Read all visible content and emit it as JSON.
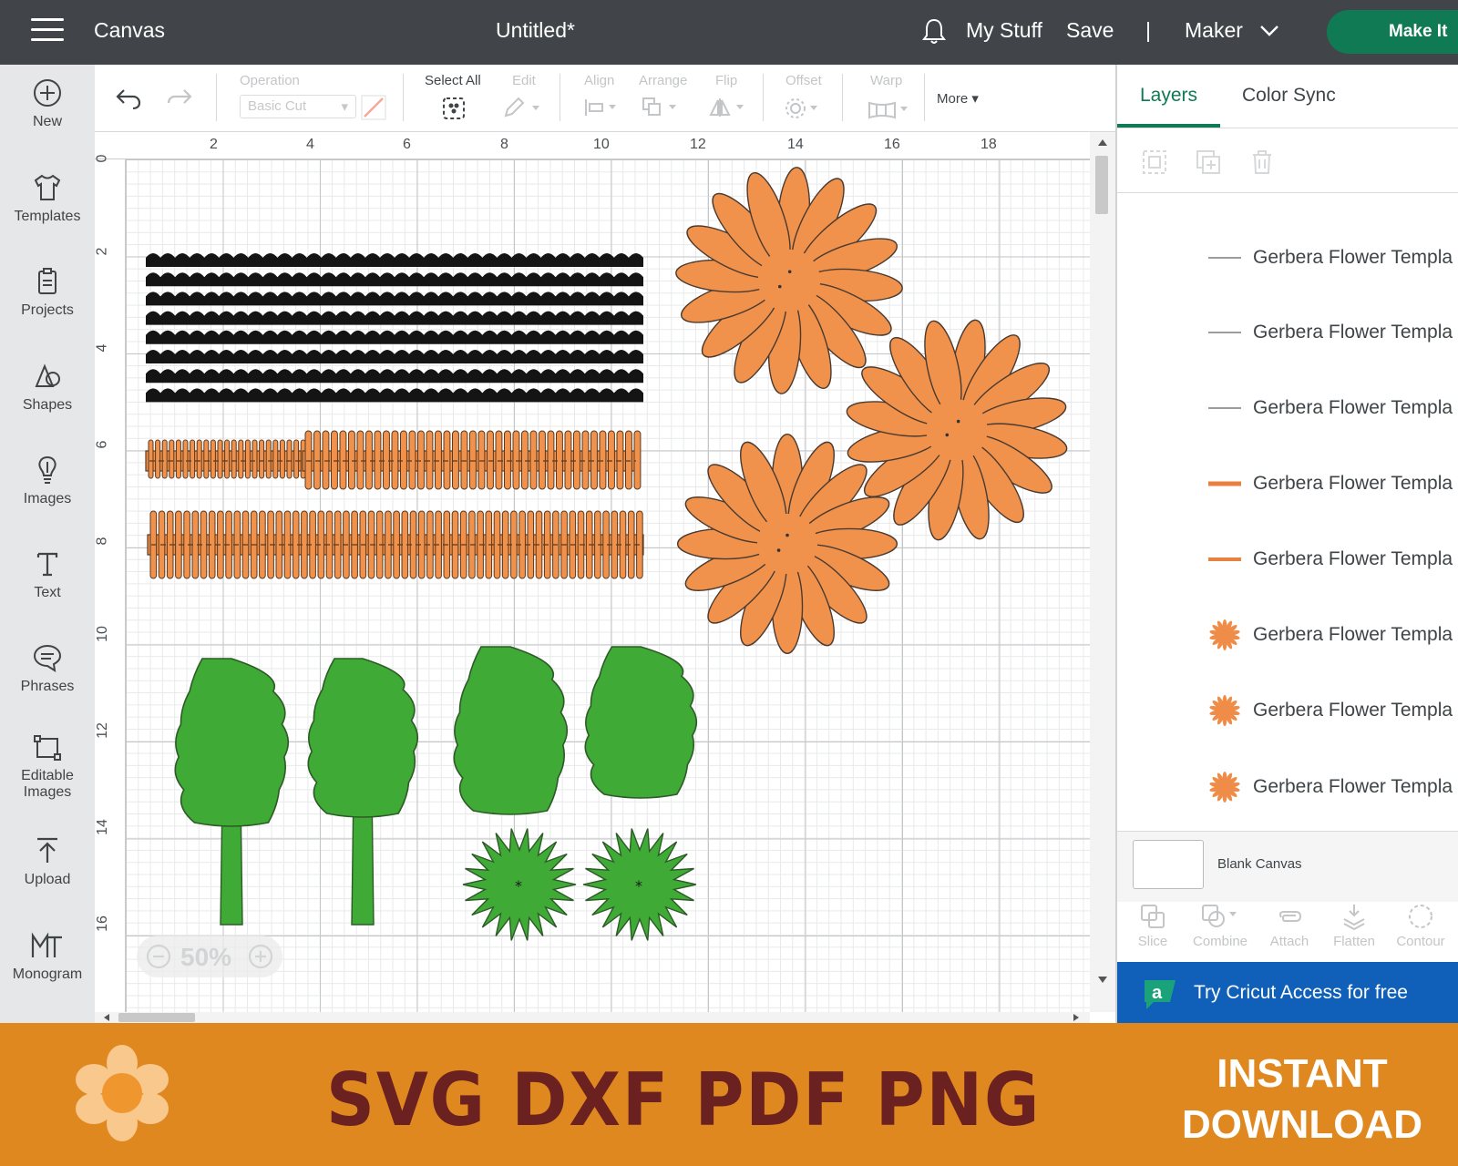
{
  "topbar": {
    "canvas_label": "Canvas",
    "doc_title": "Untitled*",
    "my_stuff": "My Stuff",
    "save": "Save",
    "divider": "|",
    "machine": "Maker",
    "make_it": "Make It"
  },
  "sidebar": {
    "items": [
      {
        "label": "New",
        "icon": "plus-circle-icon"
      },
      {
        "label": "Templates",
        "icon": "shirt-icon"
      },
      {
        "label": "Projects",
        "icon": "clipboard-icon"
      },
      {
        "label": "Shapes",
        "icon": "shapes-icon"
      },
      {
        "label": "Images",
        "icon": "lightbulb-icon"
      },
      {
        "label": "Text",
        "icon": "text-t-icon"
      },
      {
        "label": "Phrases",
        "icon": "speech-bubble-icon"
      },
      {
        "label": "Editable\nImages",
        "label_line1": "Editable",
        "label_line2": "Images",
        "icon": "editable-images-icon"
      },
      {
        "label": "Upload",
        "icon": "upload-arrow-icon"
      },
      {
        "label": "Monogram",
        "icon": "monogram-icon"
      }
    ]
  },
  "toolbar": {
    "operation_label": "Operation",
    "operation_value": "Basic Cut",
    "select_all": "Select All",
    "edit": "Edit",
    "align": "Align",
    "arrange": "Arrange",
    "flip": "Flip",
    "offset": "Offset",
    "warp": "Warp",
    "more": "More"
  },
  "canvas": {
    "ruler_h": [
      "2",
      "4",
      "6",
      "8",
      "10",
      "12",
      "14",
      "16",
      "18"
    ],
    "ruler_v": [
      "0",
      "2",
      "4",
      "6",
      "8",
      "10",
      "12",
      "14",
      "16"
    ],
    "zoom": "50%",
    "colors": {
      "black": "#141414",
      "orange": "#f0924c",
      "green": "#3faa35"
    }
  },
  "panel": {
    "tab_layers": "Layers",
    "tab_color_sync": "Color Sync",
    "layers": [
      {
        "name": "Gerbera Flower Templa",
        "swatch": "line-gray"
      },
      {
        "name": "Gerbera Flower Templa",
        "swatch": "line-gray"
      },
      {
        "name": "Gerbera Flower Templa",
        "swatch": "line-gray"
      },
      {
        "name": "Gerbera Flower Templa",
        "swatch": "line-orange"
      },
      {
        "name": "Gerbera Flower Templa",
        "swatch": "line-orange"
      },
      {
        "name": "Gerbera Flower Templa",
        "swatch": "flower-orange"
      },
      {
        "name": "Gerbera Flower Templa",
        "swatch": "flower-orange"
      },
      {
        "name": "Gerbera Flower Templa",
        "swatch": "flower-orange"
      }
    ],
    "blank_canvas": "Blank Canvas",
    "actions": [
      "Slice",
      "Combine",
      "Attach",
      "Flatten",
      "Contour"
    ],
    "access": "Try Cricut Access for free"
  },
  "banner": {
    "formats": "SVG DXF PDF PNG",
    "instant_line1": "INSTANT",
    "instant_line2": "DOWNLOAD"
  }
}
